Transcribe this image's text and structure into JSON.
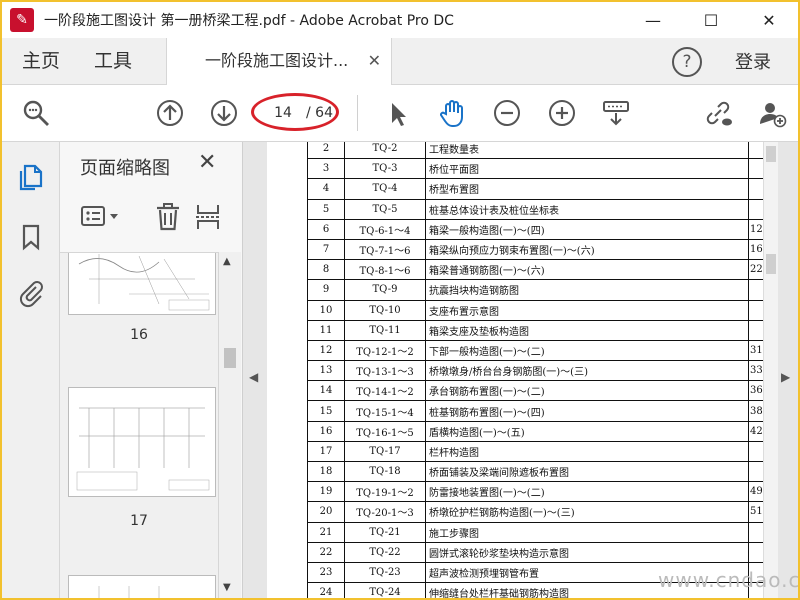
{
  "window": {
    "title": "一阶段施工图设计    第一册桥梁工程.pdf - Adobe Acrobat Pro DC",
    "minimize": "—",
    "maximize": "☐",
    "close": "✕"
  },
  "menu": {
    "home": "主页",
    "tools": "工具",
    "tab_title": "一阶段施工图设计...",
    "tab_close": "✕",
    "help": "?",
    "login": "登录"
  },
  "toolbar": {
    "current_page": "14",
    "total_pages": "/ 64"
  },
  "thumbnails": {
    "title": "页面缩略图",
    "close": "✕",
    "pages": [
      "16",
      "17"
    ]
  },
  "document": {
    "rows": [
      {
        "no": "2",
        "code": "TQ-2",
        "name": "工程数量表",
        "pg": ""
      },
      {
        "no": "3",
        "code": "TQ-3",
        "name": "桥位平面图",
        "pg": ""
      },
      {
        "no": "4",
        "code": "TQ-4",
        "name": "桥型布置图",
        "pg": ""
      },
      {
        "no": "5",
        "code": "TQ-5",
        "name": "桩基总体设计表及桩位坐标表",
        "pg": ""
      },
      {
        "no": "6",
        "code": "TQ-6-1～4",
        "name": "箱梁一般构造图(一)～(四)",
        "pg": "12"
      },
      {
        "no": "7",
        "code": "TQ-7-1～6",
        "name": "箱梁纵向预应力钢束布置图(一)～(六)",
        "pg": "16"
      },
      {
        "no": "8",
        "code": "TQ-8-1～6",
        "name": "箱梁普通钢筋图(一)～(六)",
        "pg": "22"
      },
      {
        "no": "9",
        "code": "TQ-9",
        "name": "抗震挡块构造钢筋图",
        "pg": ""
      },
      {
        "no": "10",
        "code": "TQ-10",
        "name": "支座布置示意图",
        "pg": ""
      },
      {
        "no": "11",
        "code": "TQ-11",
        "name": "箱梁支座及垫板构造图",
        "pg": ""
      },
      {
        "no": "12",
        "code": "TQ-12-1～2",
        "name": "下部一般构造图(一)～(二)",
        "pg": "31"
      },
      {
        "no": "13",
        "code": "TQ-13-1～3",
        "name": "桥墩墩身/桥台台身钢筋图(一)～(三)",
        "pg": "33"
      },
      {
        "no": "14",
        "code": "TQ-14-1～2",
        "name": "承台钢筋布置图(一)～(二)",
        "pg": "36"
      },
      {
        "no": "15",
        "code": "TQ-15-1～4",
        "name": "桩基钢筋布置图(一)～(四)",
        "pg": "38"
      },
      {
        "no": "16",
        "code": "TQ-16-1～5",
        "name": "盾横构造图(一)～(五)",
        "pg": "42"
      },
      {
        "no": "17",
        "code": "TQ-17",
        "name": "栏杆构造图",
        "pg": ""
      },
      {
        "no": "18",
        "code": "TQ-18",
        "name": "桥面铺装及梁端间隙遮板布置图",
        "pg": ""
      },
      {
        "no": "19",
        "code": "TQ-19-1～2",
        "name": "防雷接地装置图(一)～(二)",
        "pg": "49"
      },
      {
        "no": "20",
        "code": "TQ-20-1～3",
        "name": "桥墩砼护栏钢筋构造图(一)～(三)",
        "pg": "51"
      },
      {
        "no": "21",
        "code": "TQ-21",
        "name": "施工步骤图",
        "pg": ""
      },
      {
        "no": "22",
        "code": "TQ-22",
        "name": "圆饼式滚轮砂浆垫块构造示意图",
        "pg": ""
      },
      {
        "no": "23",
        "code": "TQ-23",
        "name": "超声波检测预埋钢管布置",
        "pg": ""
      },
      {
        "no": "24",
        "code": "TQ-24",
        "name": "伸缩缝台处栏杆基础钢筋构造图",
        "pg": ""
      }
    ]
  },
  "watermark": "www.cndao.com",
  "colors": {
    "accent": "#1a73c8",
    "highlight_ellipse": "#d8222a",
    "window_border": "#f2c12e"
  }
}
